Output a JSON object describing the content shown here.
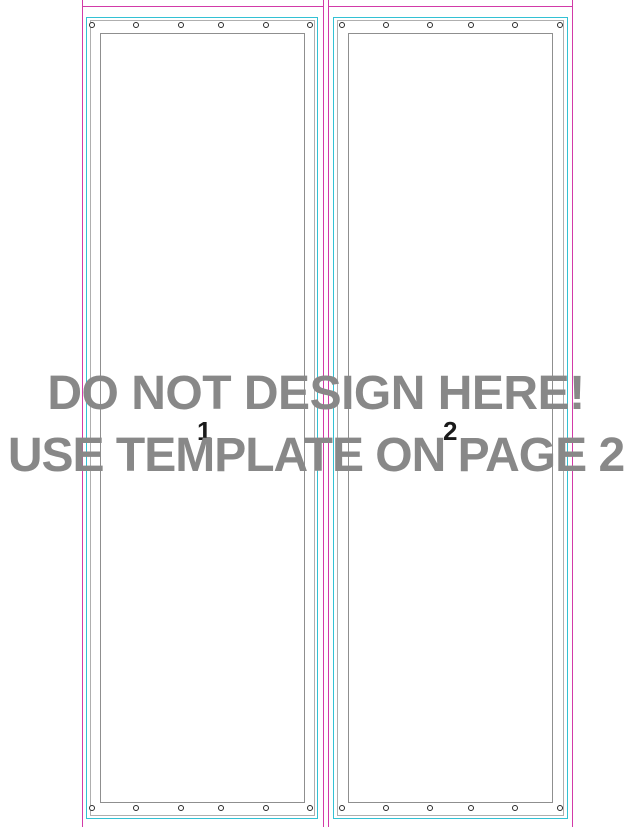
{
  "warning": {
    "line1": "DO NOT DESIGN HERE!",
    "line2": "USE TEMPLATE ON PAGE 2"
  },
  "panels": [
    {
      "number": "1"
    },
    {
      "number": "2"
    }
  ],
  "colors": {
    "bleed": "#d23aa8",
    "trim": "#33c1d4",
    "safe": "#8f8f8f",
    "warning_text": "#888888"
  }
}
